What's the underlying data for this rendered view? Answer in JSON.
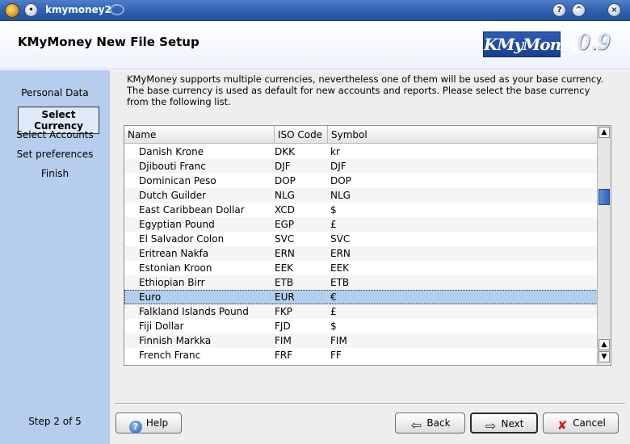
{
  "window": {
    "title": "kmymoney2",
    "buttons": {
      "help": "?",
      "minimize": "^",
      "close": "×"
    }
  },
  "header": {
    "title": "KMyMoney New File Setup",
    "logo": "KMyMoney",
    "version": "0.9"
  },
  "sidebar": {
    "steps": [
      {
        "label": "Personal Data"
      },
      {
        "label": "Select Currency"
      },
      {
        "label": "Select Accounts"
      },
      {
        "label": "Set preferences"
      },
      {
        "label": "Finish"
      }
    ],
    "active_step": "Select Currency",
    "step_count": "Step 2 of 5"
  },
  "main": {
    "description": "KMyMoney supports multiple currencies, nevertheless one of them will be used as your base currency. The base currency is used as default for new accounts and reports. Please select the base currency from the following list.",
    "table": {
      "columns": [
        "Name",
        "ISO Code",
        "Symbol"
      ],
      "rows": [
        [
          "Danish Krone",
          "DKK",
          "kr"
        ],
        [
          "Djibouti Franc",
          "DJF",
          "DJF"
        ],
        [
          "Dominican Peso",
          "DOP",
          "DOP"
        ],
        [
          "Dutch Guilder",
          "NLG",
          "NLG"
        ],
        [
          "East Caribbean Dollar",
          "XCD",
          "$"
        ],
        [
          "Egyptian Pound",
          "EGP",
          "£"
        ],
        [
          "El Salvador Colon",
          "SVC",
          "SVC"
        ],
        [
          "Eritrean Nakfa",
          "ERN",
          "ERN"
        ],
        [
          "Estonian Kroon",
          "EEK",
          "EEK"
        ],
        [
          "Ethiopian Birr",
          "ETB",
          "ETB"
        ],
        [
          "Euro",
          "EUR",
          "€"
        ],
        [
          "Falkland Islands Pound",
          "FKP",
          "£"
        ],
        [
          "Fiji Dollar",
          "FJD",
          "$"
        ],
        [
          "Finnish Markka",
          "FIM",
          "FIM"
        ],
        [
          "French Franc",
          "FRF",
          "FF"
        ]
      ],
      "selected_row": "Euro"
    }
  },
  "buttons": {
    "help": "Help",
    "back": "Back",
    "next": "Next",
    "cancel": "Cancel"
  },
  "icons": {
    "app": "kmymoney-app-icon",
    "help": "help-circle-icon",
    "back": "arrow-left-icon",
    "next": "arrow-right-icon",
    "cancel": "red-x-icon"
  }
}
